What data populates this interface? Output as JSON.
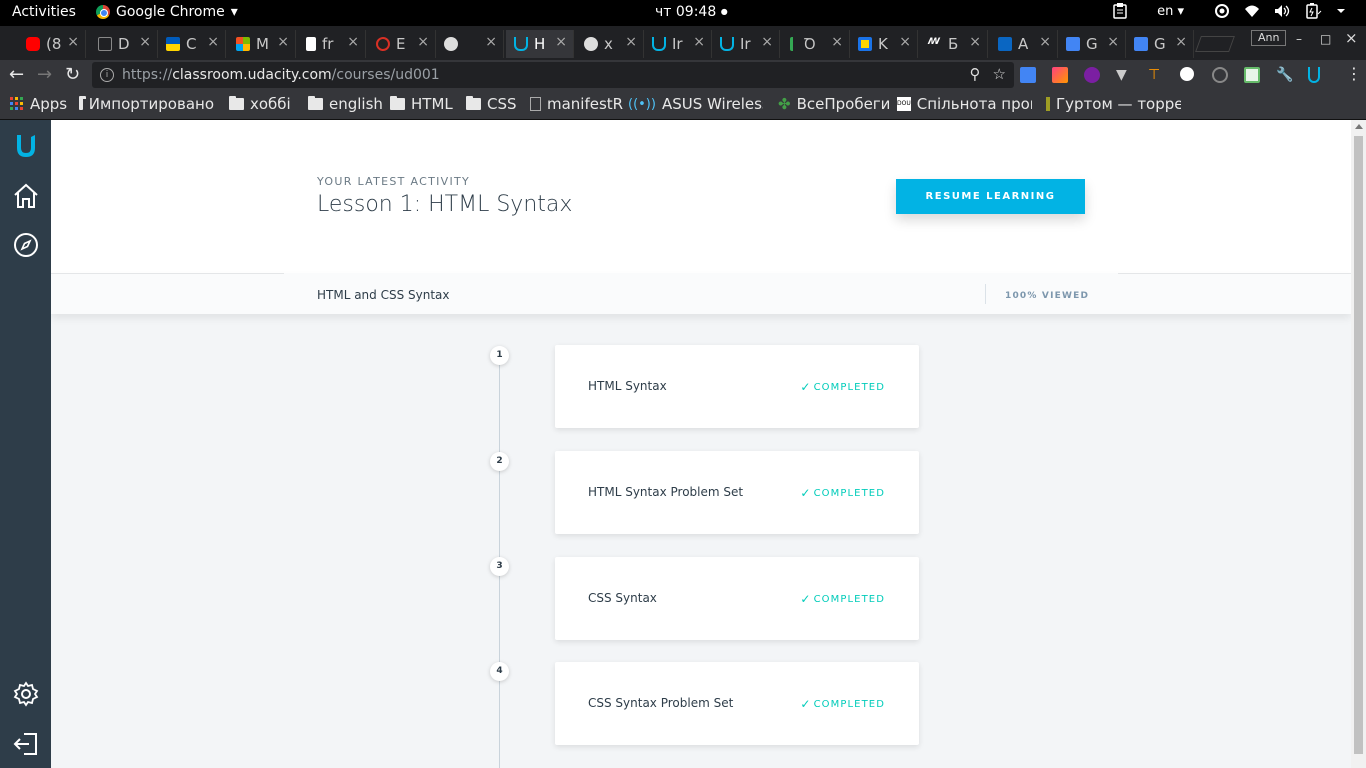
{
  "system_bar": {
    "activities": "Activities",
    "app_name": "Google Chrome",
    "app_menu_arrow": "▾",
    "clock": "чт 09:48",
    "clock_dot": "●",
    "language": "en",
    "language_arrow": "▾"
  },
  "tabs": [
    {
      "label": "(8",
      "icon": "youtube-icon",
      "color": "#ff0000"
    },
    {
      "label": "D",
      "icon": "document-icon",
      "color": "#5f6368"
    },
    {
      "label": "C",
      "icon": "flag-ua-icon",
      "color": "#f4c20d"
    },
    {
      "label": "M",
      "icon": "microsoft-icon",
      "color": "#00a4ef"
    },
    {
      "label": "fr",
      "icon": "mdn-icon",
      "color": "#ffffff"
    },
    {
      "label": "E",
      "icon": "ninja-icon",
      "color": "#d93025"
    },
    {
      "label": "",
      "icon": "github-icon",
      "color": "#dddddd"
    },
    {
      "label": "H",
      "icon": "udacity-icon",
      "color": "#02b3e4"
    },
    {
      "label": "x",
      "icon": "github-icon",
      "color": "#dddddd"
    },
    {
      "label": "Ir",
      "icon": "udacity-icon",
      "color": "#02b3e4"
    },
    {
      "label": "Ir",
      "icon": "udacity-icon",
      "color": "#02b3e4"
    },
    {
      "label": "Ꝺ",
      "icon": "audio-icon",
      "color": "#34a853"
    },
    {
      "label": "K",
      "icon": "bookmark-icon",
      "color": "#1a73e8"
    },
    {
      "label": "Б",
      "icon": "mts-icon",
      "color": "#ffffff"
    },
    {
      "label": "A",
      "icon": "linkedin-icon",
      "color": "#0a66c2"
    },
    {
      "label": "G",
      "icon": "translate-icon",
      "color": "#4285f4"
    },
    {
      "label": "G",
      "icon": "translate-icon",
      "color": "#4285f4"
    }
  ],
  "tab_close": "×",
  "profile": "Ann",
  "window_controls": {
    "minimize": "–",
    "maximize": "□",
    "close": "×"
  },
  "toolbar": {
    "back": "←",
    "forward": "→",
    "reload": "↻",
    "info": "i",
    "url_scheme": "https://",
    "url_host": "classroom.udacity.com",
    "url_path": "/courses/ud001",
    "zoom_icon": "⚲",
    "star_icon": "☆"
  },
  "bookmarks": [
    {
      "label": "Apps",
      "icon": "apps-grid-icon"
    },
    {
      "label": "Импортировано",
      "icon": "folder-icon"
    },
    {
      "label": "хоббі",
      "icon": "folder-icon"
    },
    {
      "label": "english",
      "icon": "folder-icon"
    },
    {
      "label": "HTML",
      "icon": "folder-icon"
    },
    {
      "label": "CSS",
      "icon": "folder-icon"
    },
    {
      "label": "manifestR",
      "icon": "page-icon"
    },
    {
      "label": "ASUS Wireless R",
      "icon": "wireless-icon"
    },
    {
      "label": "ВсеПробеги",
      "icon": "runner-icon"
    },
    {
      "label": "Спільнота програ",
      "icon": "dou-icon"
    },
    {
      "label": "Гуртом — торре",
      "icon": "hurtom-icon"
    }
  ],
  "hero": {
    "eyebrow": "YOUR LATEST ACTIVITY",
    "title": "Lesson 1: HTML Syntax",
    "resume_button": "RESUME LEARNING"
  },
  "course": {
    "name": "HTML and CSS Syntax",
    "progress_label": "100% VIEWED",
    "progress_percent": 100
  },
  "lessons": [
    {
      "number": "1",
      "title": "HTML Syntax",
      "status": "COMPLETED"
    },
    {
      "number": "2",
      "title": "HTML Syntax Problem Set",
      "status": "COMPLETED"
    },
    {
      "number": "3",
      "title": "CSS Syntax",
      "status": "COMPLETED"
    },
    {
      "number": "4",
      "title": "CSS Syntax Problem Set",
      "status": "COMPLETED"
    }
  ],
  "check_glyph": "✓",
  "colors": {
    "udacity_blue": "#02b3e4",
    "sidebar": "#2e3d49",
    "completed": "#02ccba"
  }
}
